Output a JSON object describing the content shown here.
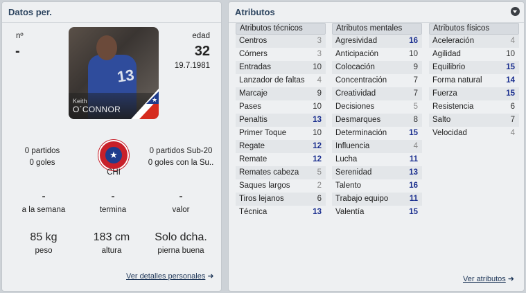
{
  "left_panel": {
    "title": "Datos per.",
    "number_label": "nº",
    "number_value": "-",
    "age_label": "edad",
    "age_value": "32",
    "birth_date": "19.7.1981",
    "photo": {
      "first_name": "Keith",
      "last_name": "O´CONNOR",
      "jersey_number": "13"
    },
    "stats_left": {
      "matches": "0 partidos",
      "goals": "0 goles"
    },
    "nation_code": "CHI",
    "stats_right": {
      "matches": "0 partidos Sub-20",
      "goals": "0 goles con la Su.."
    },
    "contract": [
      {
        "value": "-",
        "label": "a la semana"
      },
      {
        "value": "-",
        "label": "termina"
      },
      {
        "value": "-",
        "label": "valor"
      }
    ],
    "physical": [
      {
        "value": "85 kg",
        "label": "peso"
      },
      {
        "value": "183 cm",
        "label": "altura"
      },
      {
        "value": "Solo dcha.",
        "label": "pierna buena"
      }
    ],
    "link": "Ver detalles personales"
  },
  "right_panel": {
    "title": "Atributos",
    "columns": [
      {
        "header": "Atributos técnicos",
        "rows": [
          {
            "name": "Centros",
            "value": "3"
          },
          {
            "name": "Córners",
            "value": "3"
          },
          {
            "name": "Entradas",
            "value": "10"
          },
          {
            "name": "Lanzador de faltas",
            "value": "4"
          },
          {
            "name": "Marcaje",
            "value": "9"
          },
          {
            "name": "Pases",
            "value": "10"
          },
          {
            "name": "Penaltis",
            "value": "13"
          },
          {
            "name": "Primer Toque",
            "value": "10"
          },
          {
            "name": "Regate",
            "value": "12"
          },
          {
            "name": "Remate",
            "value": "12"
          },
          {
            "name": "Remates cabeza",
            "value": "5"
          },
          {
            "name": "Saques largos",
            "value": "2"
          },
          {
            "name": "Tiros lejanos",
            "value": "6"
          },
          {
            "name": "Técnica",
            "value": "13"
          }
        ]
      },
      {
        "header": "Atributos mentales",
        "rows": [
          {
            "name": "Agresividad",
            "value": "16"
          },
          {
            "name": "Anticipación",
            "value": "10"
          },
          {
            "name": "Colocación",
            "value": "9"
          },
          {
            "name": "Concentración",
            "value": "7"
          },
          {
            "name": "Creatividad",
            "value": "7"
          },
          {
            "name": "Decisiones",
            "value": "5"
          },
          {
            "name": "Desmarques",
            "value": "8"
          },
          {
            "name": "Determinación",
            "value": "15"
          },
          {
            "name": "Influencia",
            "value": "4"
          },
          {
            "name": "Lucha",
            "value": "11"
          },
          {
            "name": "Serenidad",
            "value": "13"
          },
          {
            "name": "Talento",
            "value": "16"
          },
          {
            "name": "Trabajo equipo",
            "value": "11"
          },
          {
            "name": "Valentía",
            "value": "15"
          }
        ]
      },
      {
        "header": "Atributos físicos",
        "rows": [
          {
            "name": "Aceleración",
            "value": "4"
          },
          {
            "name": "Agilidad",
            "value": "10"
          },
          {
            "name": "Equilibrio",
            "value": "15"
          },
          {
            "name": "Forma natural",
            "value": "14"
          },
          {
            "name": "Fuerza",
            "value": "15"
          },
          {
            "name": "Resistencia",
            "value": "6"
          },
          {
            "name": "Salto",
            "value": "7"
          },
          {
            "name": "Velocidad",
            "value": "4"
          }
        ]
      }
    ],
    "link": "Ver atributos"
  },
  "colors": {
    "high_value": "#1b2f8f",
    "low_value": "#8a8a8a",
    "title": "#2d4560"
  },
  "icons": {
    "collapse": "chevron-down-circle-icon",
    "link_arrow": "arrow-right-icon",
    "crest": "chile-crest-icon"
  }
}
